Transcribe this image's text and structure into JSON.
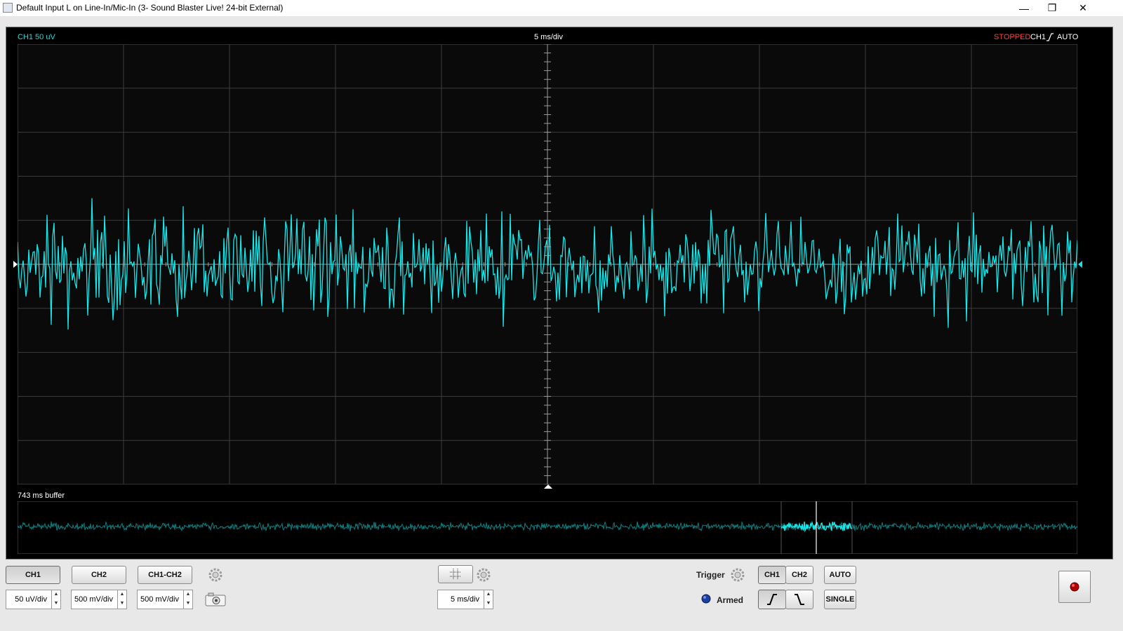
{
  "window": {
    "title": "Default Input L on Line-In/Mic-In (3- Sound Blaster Live! 24-bit External)",
    "minimize": "—",
    "restore": "❐",
    "close": "✕"
  },
  "scope": {
    "ch1_scale": "CH1 50 uV",
    "timebase": "5 ms/div",
    "status": "STOPPED",
    "trigger_channel": "CH1",
    "trigger_mode": "AUTO",
    "buffer_label": "743 ms buffer",
    "trace_color": "#18e6e8",
    "overview_color": "#0f7f80"
  },
  "controls": {
    "ch1": "CH1",
    "ch2": "CH2",
    "ch1_ch2": "CH1-CH2",
    "ch1_scale": "50 uV/div",
    "ch2_scale": "500 mV/div",
    "diff_scale": "500 mV/div",
    "timebase": "5 ms/div",
    "trigger_label": "Trigger",
    "trig_ch1": "CH1",
    "trig_ch2": "CH2",
    "auto": "AUTO",
    "single": "SINGLE",
    "armed": "Armed"
  }
}
